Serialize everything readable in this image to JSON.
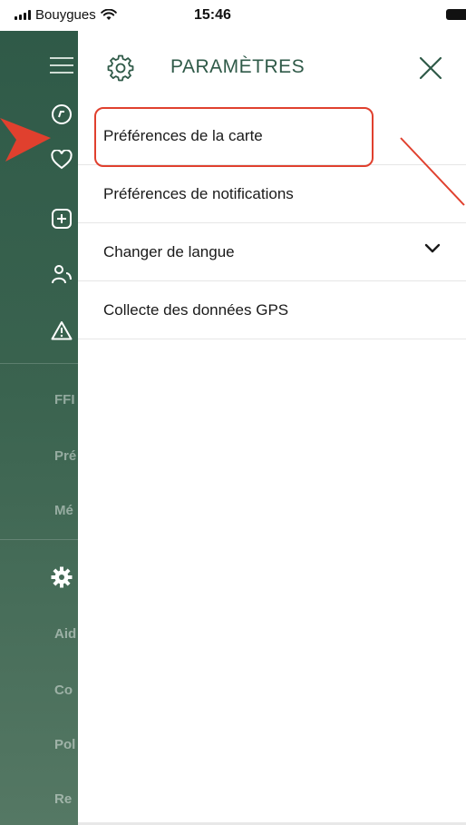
{
  "status_bar": {
    "carrier": "Bouygues",
    "time": "15:46"
  },
  "panel": {
    "title": "PARAMÈTRES",
    "items": [
      {
        "label": "Préférences de la carte"
      },
      {
        "label": "Préférences de notifications"
      },
      {
        "label": "Changer de langue",
        "has_chevron": true
      },
      {
        "label": "Collecte des données GPS"
      }
    ]
  },
  "sidebar": {
    "truncated_items": [
      "FFI",
      "Pré",
      "Mé",
      "Aid",
      "Co",
      "Pol",
      "Re"
    ]
  },
  "colors": {
    "brand_green": "#2f5a48",
    "annotation_red": "#e0402e"
  },
  "icons": {
    "panel_header": "gear-icon",
    "close": "close-icon",
    "chevron": "chevron-down-icon"
  }
}
